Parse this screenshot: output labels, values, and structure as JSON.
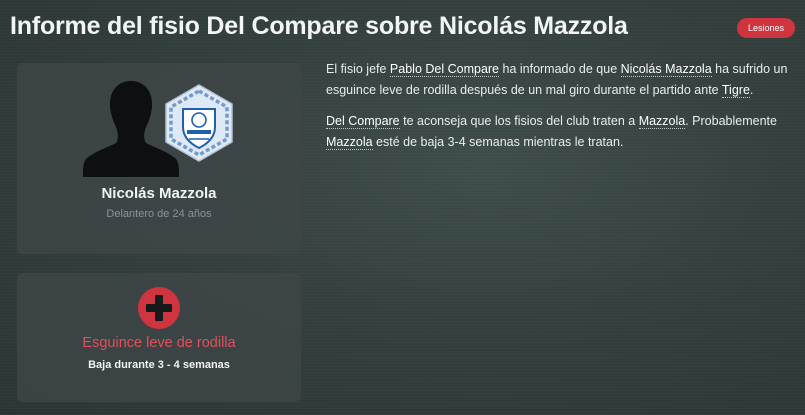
{
  "header": {
    "title": "Informe del fisio Del Compare sobre Nicolás Mazzola",
    "badge": "Lesiones"
  },
  "player_card": {
    "name": "Nicolás Mazzola",
    "description": "Delantero de 24 años",
    "avatar_icon": "person-silhouette-icon",
    "club_crest_icon": "club-crest-icon"
  },
  "injury_card": {
    "icon": "medical-cross-icon",
    "injury_name": "Esguince leve de rodilla",
    "duration": "Baja durante 3 - 4 semanas",
    "accent_color": "#d0353f"
  },
  "report": {
    "p1": {
      "t1": "El fisio jefe ",
      "l1": "Pablo Del Compare",
      "t2": " ha informado de que ",
      "l2": "Nicolás Mazzola",
      "t3": " ha sufrido un esguince leve de rodilla después de un mal giro durante el partido ante ",
      "l3": "Tigre",
      "t4": "."
    },
    "p2": {
      "l1": "Del Compare",
      "t1": " te aconseja que los fisios del club traten a ",
      "l2": "Mazzola",
      "t2": ". Probablemente ",
      "l3": "Mazzola",
      "t3": " esté de baja 3-4 semanas mientras le tratan."
    }
  }
}
